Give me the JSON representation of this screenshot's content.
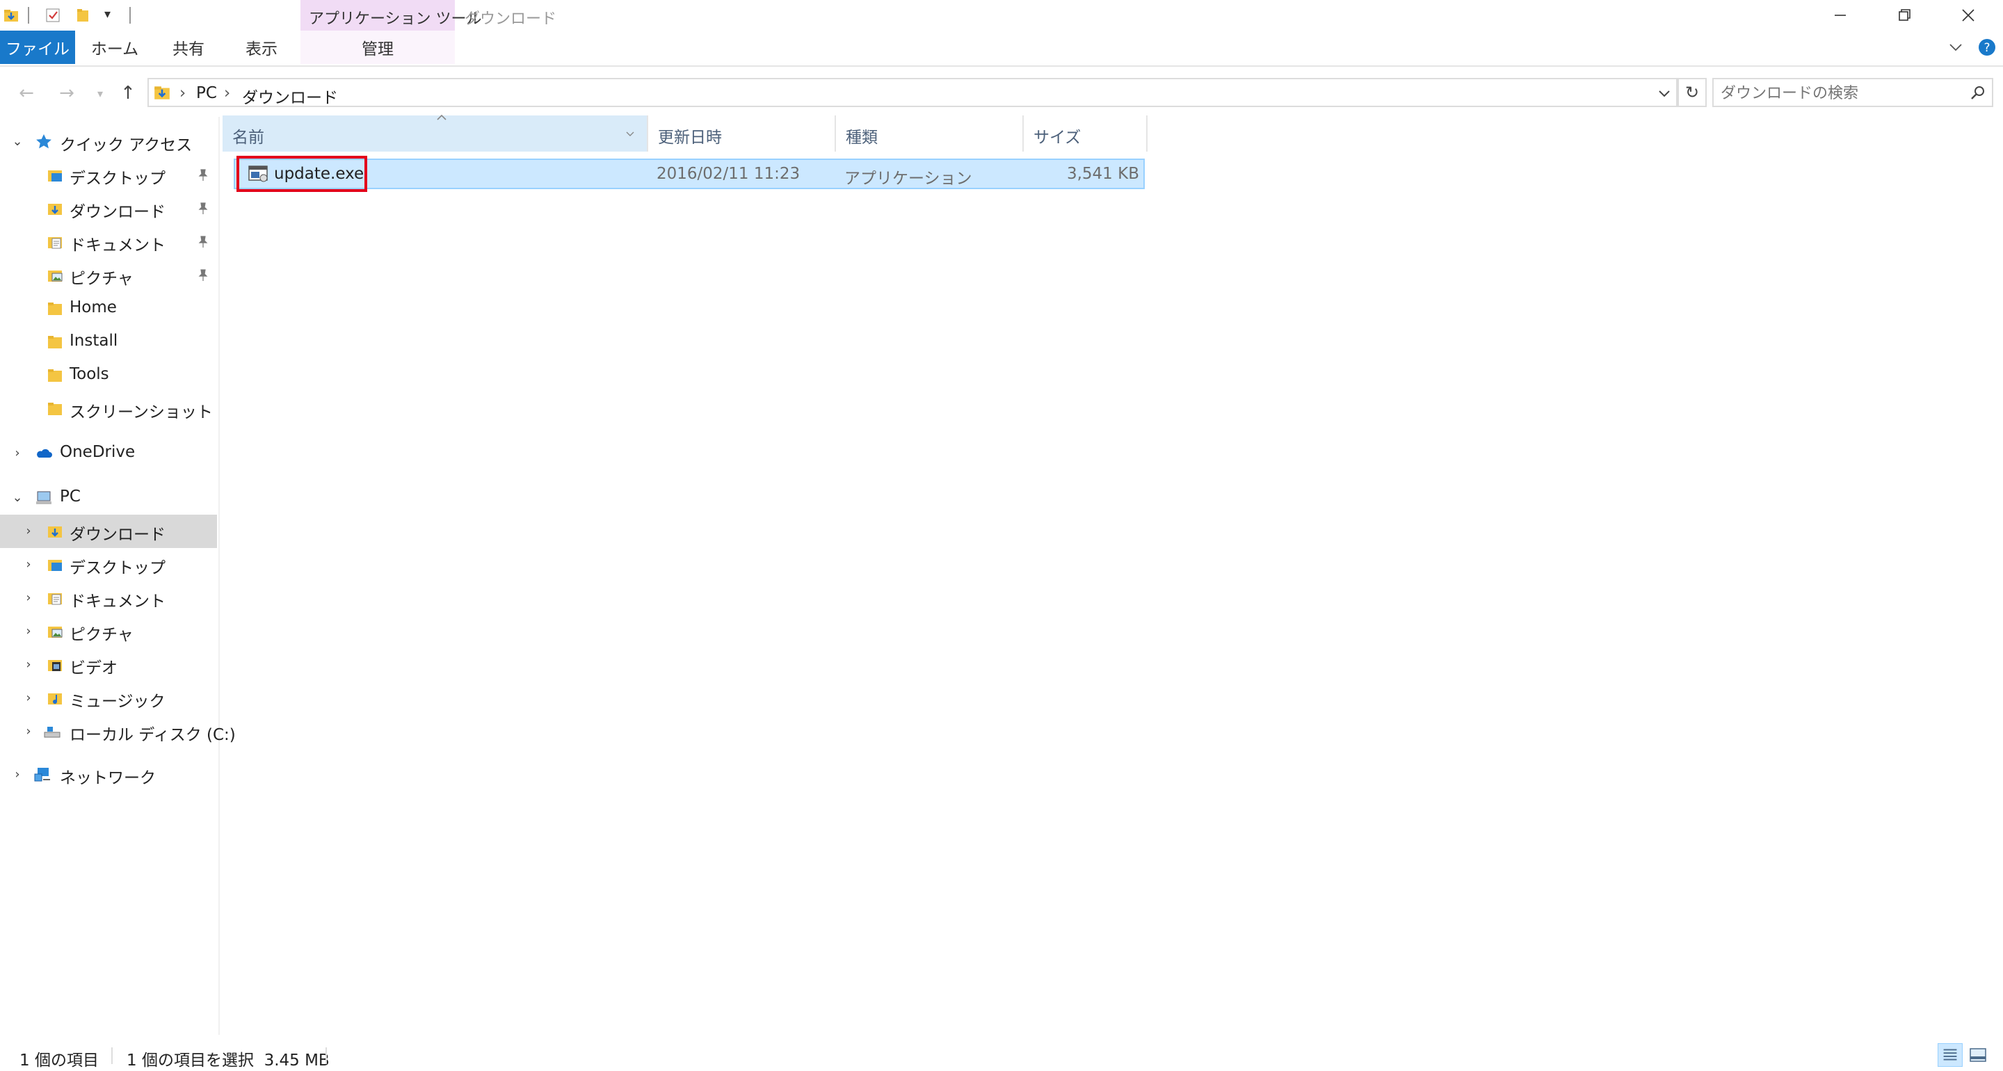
{
  "titlebar": {
    "context_tab_group": "アプリケーション ツール",
    "window_title": "ダウンロード"
  },
  "ribbon": {
    "tabs": [
      {
        "label": "ファイル"
      },
      {
        "label": "ホーム"
      },
      {
        "label": "共有"
      },
      {
        "label": "表示"
      },
      {
        "label": "管理"
      }
    ]
  },
  "address": {
    "breadcrumb": [
      "PC",
      "ダウンロード"
    ],
    "search_placeholder": "ダウンロードの検索"
  },
  "navpane": {
    "quick_access": {
      "label": "クイック アクセス",
      "items": [
        {
          "label": "デスクトップ",
          "pinned": true,
          "icon": "desktop-folder-icon"
        },
        {
          "label": "ダウンロード",
          "pinned": true,
          "icon": "downloads-folder-icon"
        },
        {
          "label": "ドキュメント",
          "pinned": true,
          "icon": "documents-folder-icon"
        },
        {
          "label": "ピクチャ",
          "pinned": true,
          "icon": "pictures-folder-icon"
        },
        {
          "label": "Home",
          "pinned": false,
          "icon": "folder-icon"
        },
        {
          "label": "Install",
          "pinned": false,
          "icon": "folder-icon"
        },
        {
          "label": "Tools",
          "pinned": false,
          "icon": "folder-icon"
        },
        {
          "label": "スクリーンショット",
          "pinned": false,
          "icon": "folder-icon"
        }
      ]
    },
    "onedrive": {
      "label": "OneDrive"
    },
    "pc": {
      "label": "PC",
      "items": [
        {
          "label": "ダウンロード",
          "selected": true,
          "icon": "downloads-folder-icon"
        },
        {
          "label": "デスクトップ",
          "icon": "desktop-folder-icon"
        },
        {
          "label": "ドキュメント",
          "icon": "documents-folder-icon"
        },
        {
          "label": "ピクチャ",
          "icon": "pictures-folder-icon"
        },
        {
          "label": "ビデオ",
          "icon": "videos-folder-icon"
        },
        {
          "label": "ミュージック",
          "icon": "music-folder-icon"
        },
        {
          "label": "ローカル ディスク (C:)",
          "icon": "local-disk-icon"
        }
      ]
    },
    "network": {
      "label": "ネットワーク"
    }
  },
  "filelist": {
    "columns": {
      "name": "名前",
      "date": "更新日時",
      "type": "種類",
      "size": "サイズ"
    },
    "rows": [
      {
        "name": "update.exe",
        "date": "2016/02/11 11:23",
        "type": "アプリケーション",
        "size": "3,541 KB",
        "selected": true
      }
    ]
  },
  "statusbar": {
    "item_count": "1 個の項目",
    "selection": "1 個の項目を選択  3.45 MB"
  },
  "colors": {
    "accent": "#1979ca",
    "selection": "#cce8ff",
    "context_tab": "#f1dcf5",
    "highlight_box": "#e3001b"
  }
}
